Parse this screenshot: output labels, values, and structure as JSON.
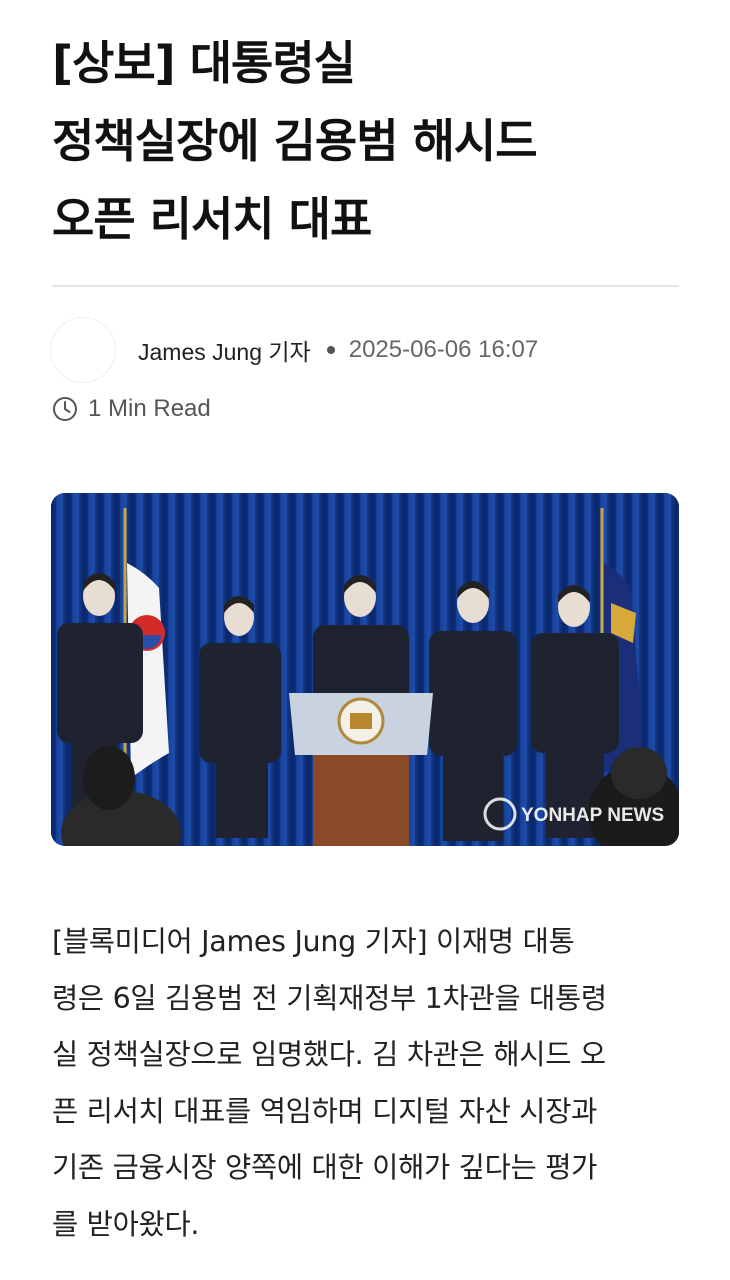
{
  "article": {
    "title_lines": [
      "[상보] 대통령실",
      "정책실장에 김용범 해시드",
      "오픈 리서치 대표"
    ],
    "author": "James Jung 기자",
    "date": "2025-06-06 16:07",
    "read_time": "1 Min Read",
    "photo": {
      "watermark": "YONHAP NEWS",
      "alt_icon": "press-conference-photo"
    },
    "body_lines": [
      "[블록미디어 James Jung 기자]  이재명 대통",
      "령은 6일 김용범 전 기획재정부 1차관을 대통령",
      "실 정책실장으로 임명했다. 김 차관은 해시드 오",
      "픈 리서치 대표를 역임하며 디지털 자산 시장과",
      "기존 금융시장 양쪽에 대한 이해가 깊다는 평가",
      "를 받아왔다."
    ]
  },
  "colors": {
    "divider": "#e6e6e6",
    "curtain": "#123a8c",
    "podium": "#c9d3df"
  }
}
